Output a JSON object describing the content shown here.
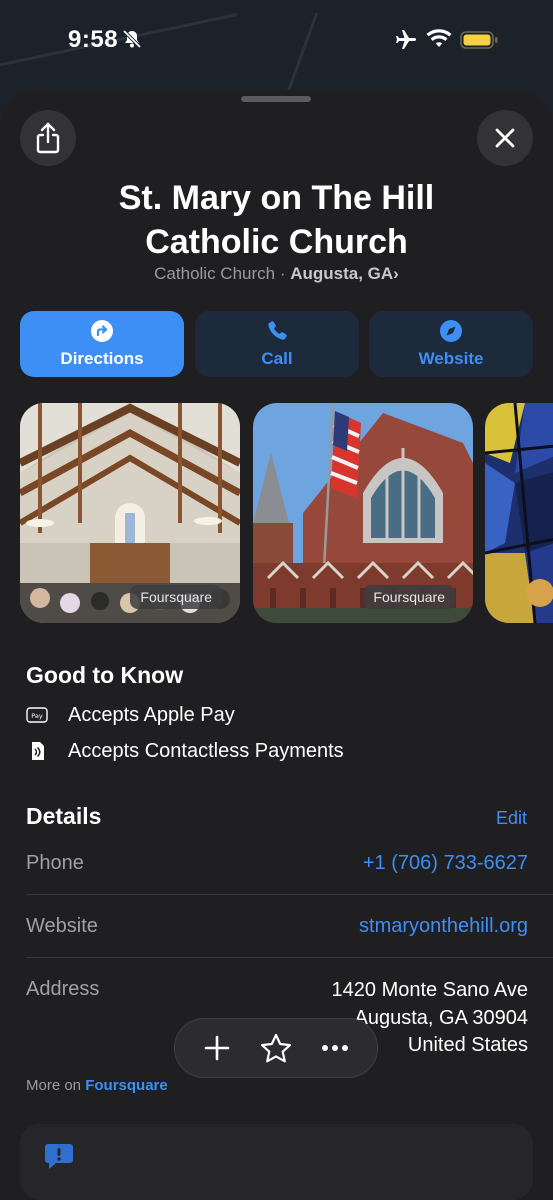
{
  "status_bar": {
    "time": "9:58",
    "icons": [
      "bell-slash-icon",
      "airplane-icon",
      "wifi-icon",
      "battery-icon"
    ],
    "battery_color": "#f5d142"
  },
  "place": {
    "name_line1": "St. Mary on The Hill",
    "name_line2": "Catholic Church",
    "category": "Catholic Church",
    "separator": " · ",
    "location": "Augusta, GA",
    "location_chevron": "›"
  },
  "actions": [
    {
      "label": "Directions",
      "icon": "directions-icon"
    },
    {
      "label": "Call",
      "icon": "phone-icon"
    },
    {
      "label": "Website",
      "icon": "compass-icon"
    }
  ],
  "photos": [
    {
      "badge": "Foursquare",
      "subject": "church interior"
    },
    {
      "badge": "Foursquare",
      "subject": "church exterior with flag"
    },
    {
      "badge": "",
      "subject": "stained glass"
    }
  ],
  "good_to_know": {
    "title": "Good to Know",
    "items": [
      {
        "label": "Accepts Apple Pay",
        "icon": "apple-pay-icon"
      },
      {
        "label": "Accepts Contactless Payments",
        "icon": "contactless-icon"
      }
    ]
  },
  "details": {
    "title": "Details",
    "edit_label": "Edit",
    "phone_label": "Phone",
    "phone_value": "+1 (706) 733-6627",
    "website_label": "Website",
    "website_value": "stmaryonthehill.org",
    "address_label": "Address",
    "address_line1": "1420 Monte Sano Ave",
    "address_line2": "Augusta, GA  30904",
    "address_line3": "United States"
  },
  "more_on": {
    "prefix": "More on ",
    "source": "Foursquare"
  },
  "toolbar": {
    "items": [
      "plus-icon",
      "star-icon",
      "more-icon"
    ]
  },
  "colors": {
    "accent": "#3d8ff5",
    "sheet_bg": "#1f1f21",
    "secondary_text": "#9a9aa0"
  }
}
